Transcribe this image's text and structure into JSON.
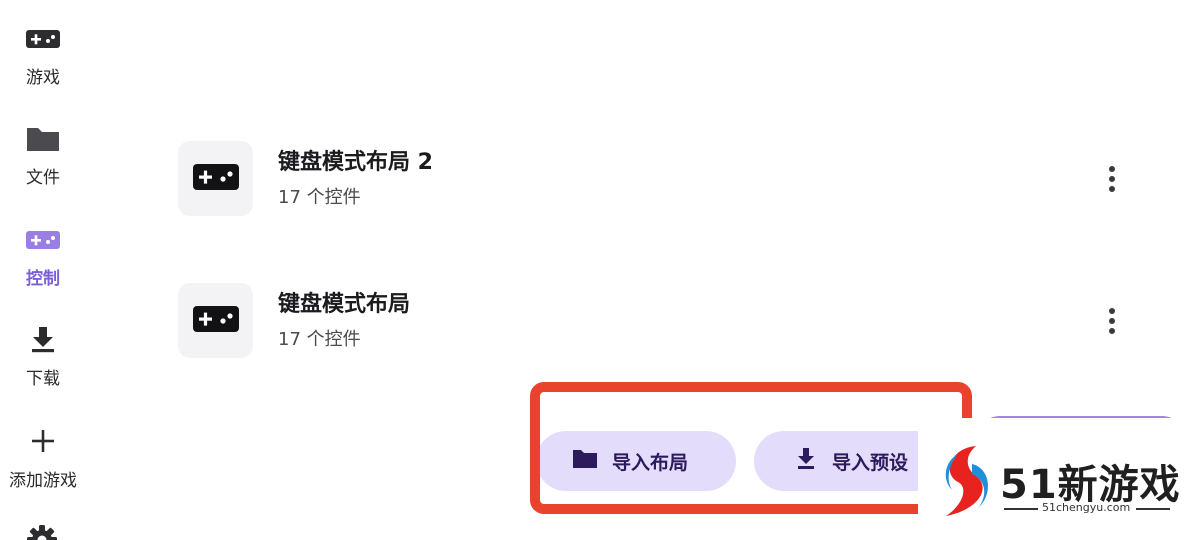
{
  "nav": {
    "items": [
      {
        "id": "games",
        "label": "游戏",
        "icon": "gamepad-icon"
      },
      {
        "id": "files",
        "label": "文件",
        "icon": "folder-icon"
      },
      {
        "id": "controls",
        "label": "控制",
        "icon": "gamepad-icon",
        "active": true
      },
      {
        "id": "downloads",
        "label": "下载",
        "icon": "download-icon"
      },
      {
        "id": "add_game",
        "label": "添加游戏",
        "icon": "plus-icon"
      }
    ],
    "settings_icon": "gear-icon",
    "active_color": "#7c5fd6"
  },
  "layouts": [
    {
      "title": "键盘模式布局 2",
      "subtitle": "17 个控件",
      "icon": "gamepad-icon"
    },
    {
      "title": "键盘模式布局",
      "subtitle": "17 个控件",
      "icon": "gamepad-icon"
    }
  ],
  "actions": {
    "import_layout": {
      "label": "导入布局",
      "icon": "folder-icon"
    },
    "import_preset": {
      "label": "导入预设",
      "icon": "download-icon"
    }
  },
  "colors": {
    "pill_bg": "#e3dcfb",
    "fab": "#a283e6",
    "highlight": "#e8432c"
  },
  "watermark": {
    "brand": "51新游戏",
    "url": "51chengyu.com"
  }
}
